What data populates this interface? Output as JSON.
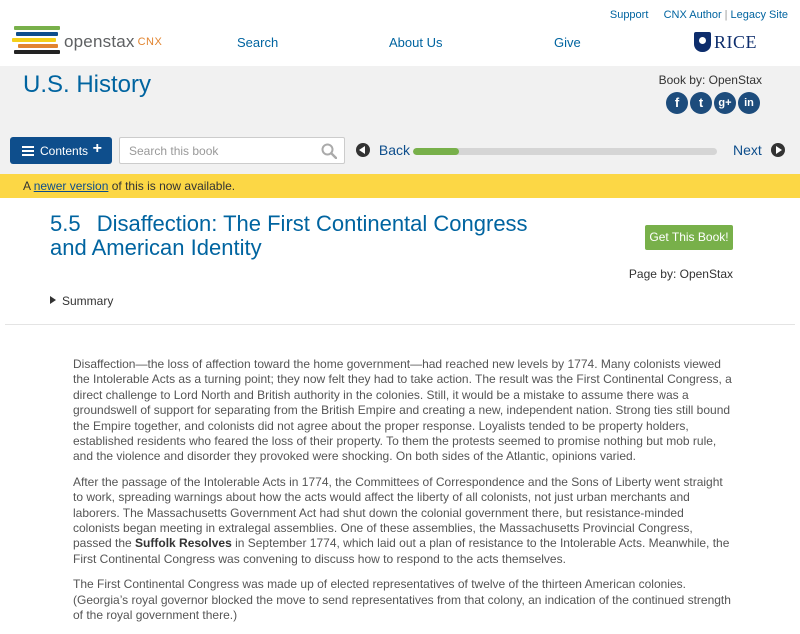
{
  "header": {
    "logo_text": "openstax",
    "logo_suffix": "CNX",
    "links": {
      "support": "Support",
      "cnx_author": "CNX Author",
      "legacy_site": "Legacy Site"
    },
    "nav": {
      "search": "Search",
      "about": "About Us",
      "give": "Give"
    },
    "rice_logo": "RICE"
  },
  "book": {
    "title": "U.S. History",
    "book_by": "Book by: OpenStax",
    "social": [
      "f",
      "t",
      "g+",
      "in"
    ]
  },
  "toolbar": {
    "contents_label": "Contents",
    "search_placeholder": "Search this book",
    "back_label": "Back",
    "next_label": "Next",
    "progress_fraction": 0.15
  },
  "notice": {
    "prefix": "A ",
    "link": "newer version",
    "suffix": " of this is now available."
  },
  "module": {
    "number": "5.5",
    "title": "Disaffection: The First Continental Congress and American Identity",
    "get_book": "Get This Book!",
    "page_by": "Page by: OpenStax",
    "summary": "Summary"
  },
  "content": {
    "p1": "Disaffection—the loss of affection toward the home government—had reached new levels by 1774. Many colonists viewed the Intolerable Acts as a turning point; they now felt they had to take action. The result was the First Continental Congress, a direct challenge to Lord North and British authority in the colonies. Still, it would be a mistake to assume there was a groundswell of support for separating from the British Empire and creating a new, independent nation. Strong ties still bound the Empire together, and colonists did not agree about the proper response. Loyalists tended to be property holders, established residents who feared the loss of their property. To them the protests seemed to promise nothing but mob rule, and the violence and disorder they provoked were shocking. On both sides of the Atlantic, opinions varied.",
    "p2_a": "After the passage of the Intolerable Acts in 1774, the Committees of Correspondence and the Sons of Liberty went straight to work, spreading warnings about how the acts would affect the liberty of all colonists, not just urban merchants and laborers. The Massachusetts Government Act had shut down the colonial government there, but resistance-minded colonists began meeting in extralegal assemblies. One of these assemblies, the Massachusetts Provincial Congress, passed the ",
    "p2_bold": "Suffolk Resolves",
    "p2_b": " in September 1774, which laid out a plan of resistance to the Intolerable Acts. Meanwhile, the First Continental Congress was convening to discuss how to respond to the acts themselves.",
    "p3": "The First Continental Congress was made up of elected representatives of twelve of the thirteen American colonies. (Georgia’s royal governor blocked the move to send representatives from that colony, an indication of the continued strength of the royal government there.)"
  },
  "colors": {
    "brand_blue": "#0064a0",
    "button_blue": "#0e4e8c",
    "green": "#78b04a",
    "notice_yellow": "#fcd745",
    "band_gray": "#f1f1f1"
  }
}
